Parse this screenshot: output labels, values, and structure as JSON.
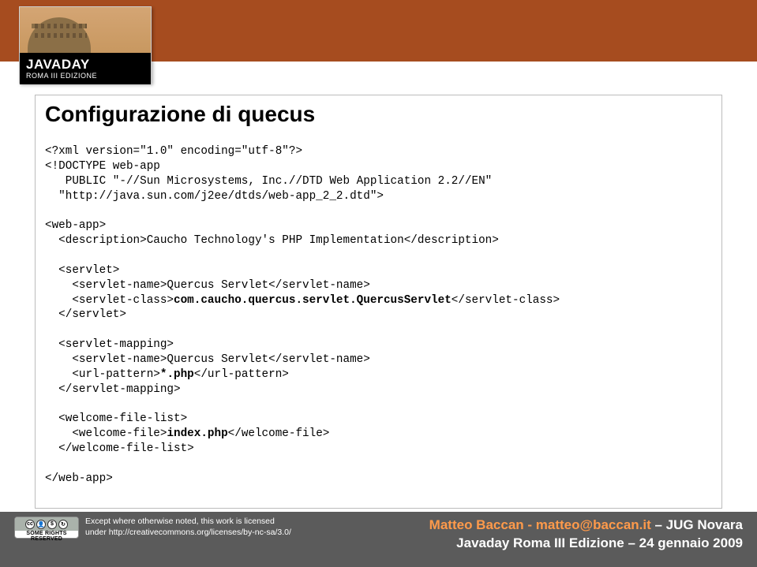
{
  "logo": {
    "main_pre": "JAVADAY",
    "sub": "ROMA III EDIZIONE"
  },
  "slide": {
    "title": "Configurazione di quecus",
    "code": {
      "l01": "<?xml version=\"1.0\" encoding=\"utf-8\"?>",
      "l02": "<!DOCTYPE web-app",
      "l03": "   PUBLIC \"-//Sun Microsystems, Inc.//DTD Web Application 2.2//EN\"",
      "l04": "  \"http://java.sun.com/j2ee/dtds/web-app_2_2.dtd\">",
      "l05": "",
      "l06": "<web-app>",
      "l07": "  <description>Caucho Technology's PHP Implementation</description>",
      "l08": "",
      "l09": "  <servlet>",
      "l10": "    <servlet-name>Quercus Servlet</servlet-name>",
      "l11a": "    <servlet-class>",
      "l11b": "com.caucho.quercus.servlet.QuercusServlet",
      "l11c": "</servlet-class>",
      "l12": "  </servlet>",
      "l13": "",
      "l14": "  <servlet-mapping>",
      "l15": "    <servlet-name>Quercus Servlet</servlet-name>",
      "l16a": "    <url-pattern>",
      "l16b": "*.php",
      "l16c": "</url-pattern>",
      "l17": "  </servlet-mapping>",
      "l18": "",
      "l19": "  <welcome-file-list>",
      "l20a": "    <welcome-file>",
      "l20b": "index.php",
      "l20c": "</welcome-file>",
      "l21": "  </welcome-file-list>",
      "l22": "",
      "l23": "</web-app>"
    }
  },
  "footer": {
    "license_line1": "Except where otherwise noted, this work is licensed",
    "license_line2": "under http://creativecommons.org/licenses/by-nc-sa/3.0/",
    "cc_text": "SOME RIGHTS RESERVED",
    "author_pre": "Matteo Baccan - matteo@baccan.it",
    "author_suf": " – JUG Novara",
    "event": "Javaday Roma III Edizione – 24 gennaio 2009"
  }
}
